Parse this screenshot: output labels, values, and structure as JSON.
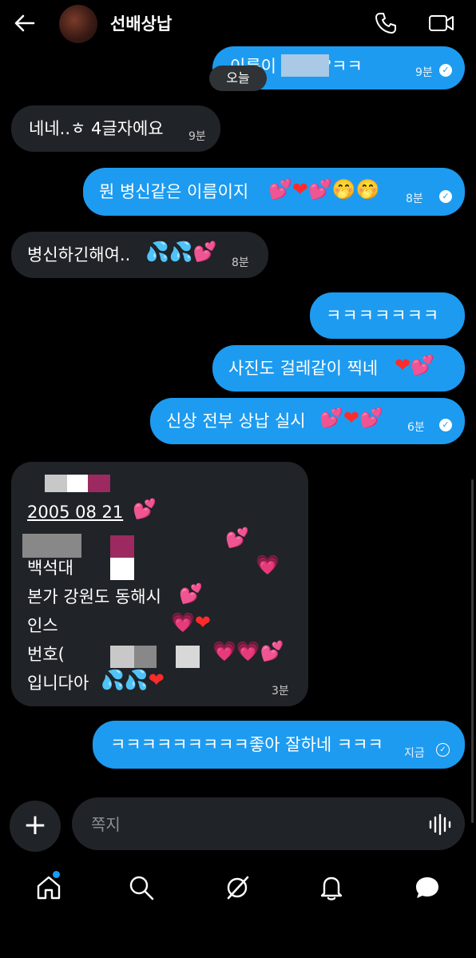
{
  "header": {
    "title": "선배상납",
    "back_icon": "arrow-left-icon",
    "call_icon": "phone-icon",
    "video_icon": "video-camera-icon"
  },
  "date_chip": "오늘",
  "messages": {
    "m0_text": "이름이 ",
    "m0_tail": "?ㅋㅋ",
    "m0_time": "9분",
    "m1_text": "네네..ㅎ 4글자에요",
    "m1_time": "9분",
    "m2_text": "뭔 병신같은 이름이지",
    "m2_time": "8분",
    "m3_text": "병신하긴해여..",
    "m3_time": "8분",
    "m4_text": "ㅋㅋㅋㅋㅋㅋㅋ",
    "m5_text": "사진도 걸레같이 찍네",
    "m6_text": "신상 전부 상납 실시",
    "m6_time": "6분",
    "m7_line1": "2005 08 21",
    "m7_line2": "백석대 ",
    "m7_line3": "본가 강원도 동해시",
    "m7_line4": "인스",
    "m7_line5": "번호(",
    "m7_line6": "입니다아",
    "m7_time": "3분",
    "m8_text": "ㅋㅋㅋㅋㅋㅋㅋㅋㅋ좋아 잘하네 ㅋㅋㅋ",
    "m8_time": "지금"
  },
  "composer": {
    "placeholder": "쪽지",
    "plus_icon": "plus-icon",
    "voice_icon": "voice-wave-icon"
  },
  "nav": [
    "home-icon",
    "search-icon",
    "grok-icon",
    "bell-icon",
    "messages-icon"
  ],
  "colors": {
    "accent": "#1d9bf0",
    "incoming_bubble": "#202327",
    "background": "#000000"
  }
}
